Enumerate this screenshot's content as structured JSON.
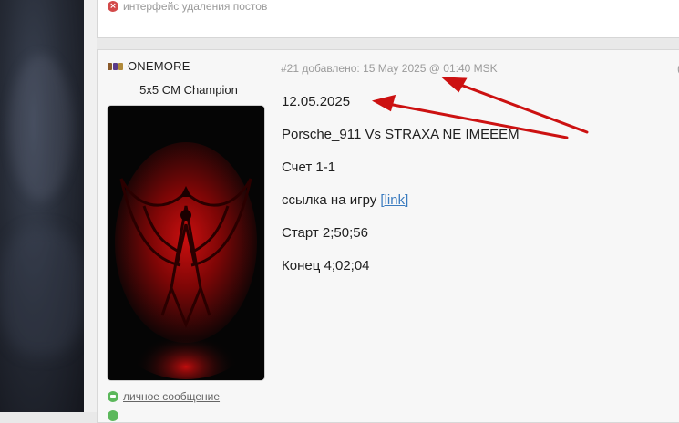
{
  "previous_post": {
    "delete_interface_label": "интерфейс удаления постов"
  },
  "post": {
    "author": {
      "name": "ONEMORE",
      "title": "5x5 CM Champion"
    },
    "meta": {
      "number": "#21",
      "added_label": "добавлено:",
      "date": "15 May 2025 @ 01:40 MSK"
    },
    "right_stub": "(",
    "content": {
      "date": "12.05.2025",
      "match": "Porsche_911 Vs STRAXA NE IMEEEM",
      "score": "Счет 1-1",
      "link_prefix": "ссылка на игру ",
      "link_text": "[link]",
      "start": "Старт 2;50;56",
      "end": "Конец 4;02;04"
    },
    "private_message_label": "личное сообщение"
  },
  "colors": {
    "arrow": "#cc1111",
    "link": "#3a7bbf",
    "pm_icon": "#5cb85c",
    "delete_icon": "#d34a4a"
  }
}
